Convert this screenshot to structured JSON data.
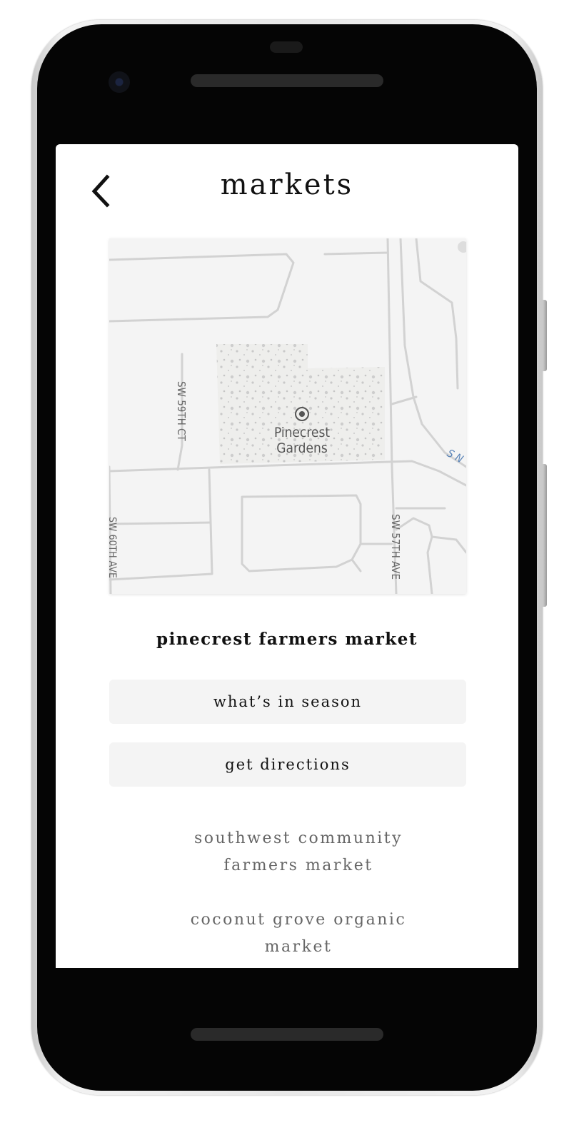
{
  "screen": {
    "title": "markets",
    "back_icon": "chevron-left-icon"
  },
  "map": {
    "place_name_line1": "Pinecrest",
    "place_name_line2": "Gardens",
    "street_sw59th": "SW 59TH CT",
    "street_sw60th": "SW 60TH AVE",
    "street_sw57th": "SW 57TH AVE",
    "water_label": "S N",
    "pin_icon": "location-target-icon"
  },
  "selected_market": {
    "name": "pinecrest farmers market",
    "season_button": "what’s in season",
    "directions_button": "get directions"
  },
  "other_markets": [
    {
      "line1": "southwest community",
      "line2": "farmers market"
    },
    {
      "line1": "coconut grove organic",
      "line2": "market"
    }
  ],
  "colors": {
    "button_bg": "#f4f4f4",
    "text_dark": "#111111",
    "text_muted": "#666666",
    "map_road": "#d2d2d2",
    "map_bg": "#f4f4f4"
  }
}
